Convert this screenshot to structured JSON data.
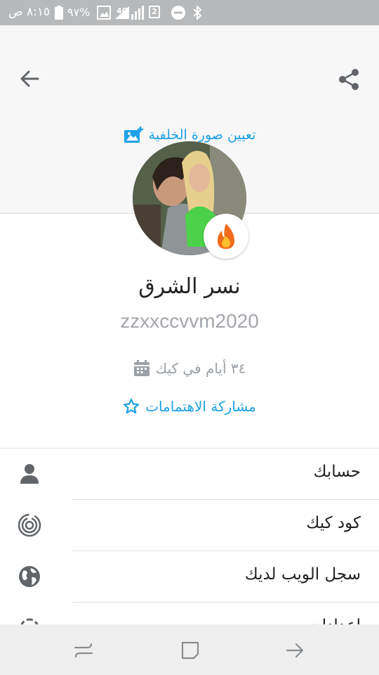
{
  "status_bar": {
    "time": "٨:١٥ ص",
    "battery_percent": "%٩٧",
    "network_label": "4G",
    "sim_badge": "2"
  },
  "header": {
    "set_background_label": "تعيين صورة الخلفية"
  },
  "profile": {
    "display_name": "نسر الشرق",
    "username": "zzxxccvvm2020",
    "days_label": "٣٤ أيام في كيك",
    "interests_label": "مشاركة الاهتمامات"
  },
  "menu": {
    "items": [
      {
        "label": "حسابك",
        "icon": "person-icon"
      },
      {
        "label": "كود كيك",
        "icon": "kik-code-icon"
      },
      {
        "label": "سجل الويب لديك",
        "icon": "globe-icon"
      },
      {
        "label": "إعدادات",
        "icon": "settings-icon"
      }
    ]
  },
  "colors": {
    "accent": "#1ea1e6",
    "status_bar": "#b7b9bb",
    "header_bg": "#f7f7f8",
    "muted_text": "#9aa0a6",
    "icon_gray": "#616569"
  }
}
